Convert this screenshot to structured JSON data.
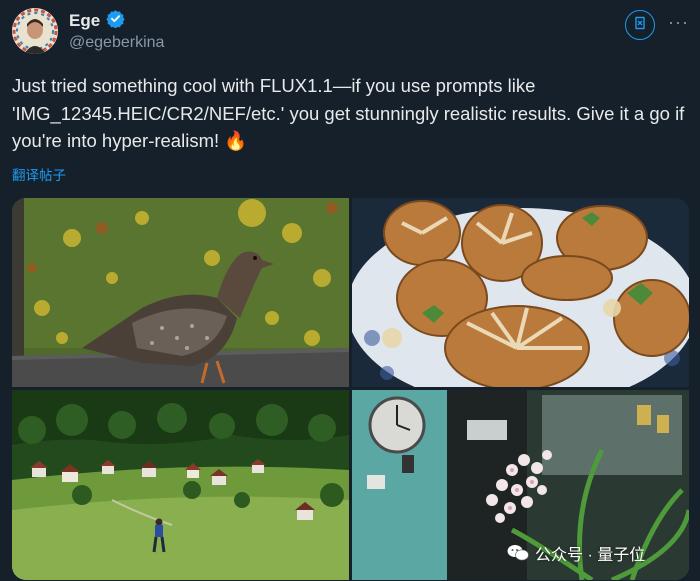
{
  "author": {
    "display_name": "Ege",
    "handle": "@egeberkina",
    "verified": true
  },
  "tweet": {
    "text": "Just tried something cool with FLUX1.1—if you use prompts like 'IMG_12345.HEIC/CR2/NEF/etc.' you get stunningly realistic results. Give it a go if you're into hyper-realism! 🔥",
    "translate_label": "翻译帖子"
  },
  "media": [
    {
      "subject": "grouse on asphalt with autumn leaves"
    },
    {
      "subject": "pastries on plate"
    },
    {
      "subject": "alpine village meadow with walking person"
    },
    {
      "subject": "clock and orchid plant"
    }
  ],
  "watermark": {
    "text": "公众号 · 量子位"
  },
  "colors": {
    "background": "#15202b",
    "accent": "#1d9bf0",
    "secondary_text": "#8b98a5"
  },
  "icons": [
    "verified-badge-icon",
    "grok-icon",
    "more-options-icon",
    "fire-emoji",
    "wechat-icon"
  ]
}
